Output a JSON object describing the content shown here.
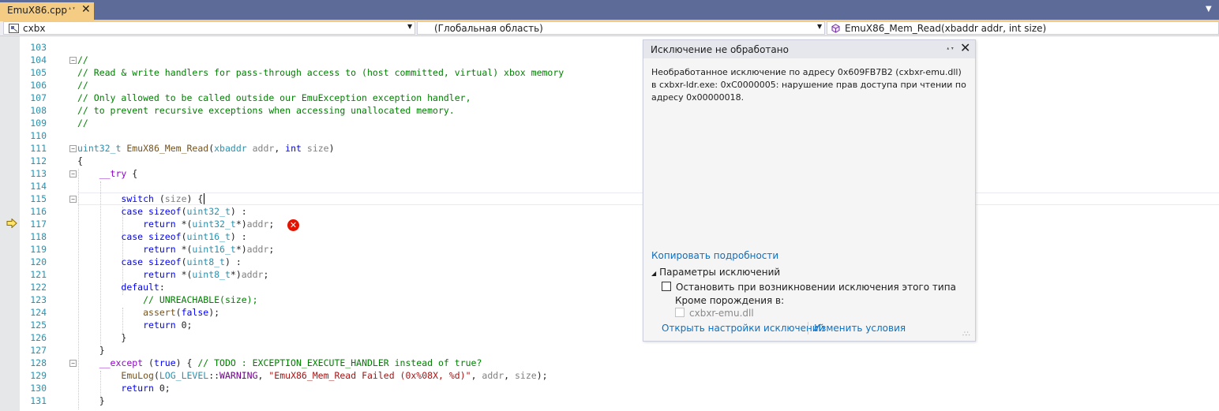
{
  "tab": {
    "title": "EmuX86.cpp",
    "pin_icon": "pin-icon",
    "close_icon": "close-icon"
  },
  "navbar": {
    "project": "cxbx",
    "scope": "(Глобальная область)",
    "member": "EmuX86_Mem_Read(xbaddr addr, int size)"
  },
  "code": {
    "line_numbers": [
      "103",
      "104",
      "105",
      "106",
      "107",
      "108",
      "109",
      "110",
      "111",
      "112",
      "113",
      "114",
      "115",
      "116",
      "117",
      "118",
      "119",
      "120",
      "121",
      "122",
      "123",
      "124",
      "125",
      "126",
      "127",
      "128",
      "129",
      "130",
      "131"
    ],
    "lines": [
      "",
      "//",
      "// Read & write handlers for pass-through access to (host committed, virtual) xbox memory",
      "//",
      "// Only allowed to be called outside our EmuException exception handler,",
      "// to prevent recursive exceptions when accessing unallocated memory.",
      "//",
      "",
      "uint32_t EmuX86_Mem_Read(xbaddr addr, int size)",
      "{",
      "    __try {",
      "",
      "        switch (size) {",
      "        case sizeof(uint32_t) :",
      "            return *(uint32_t*)addr;",
      "        case sizeof(uint16_t) :",
      "            return *(uint16_t*)addr;",
      "        case sizeof(uint8_t) :",
      "            return *(uint8_t*)addr;",
      "        default:",
      "            // UNREACHABLE(size);",
      "            assert(false);",
      "            return 0;",
      "        }",
      "    }",
      "    __except (true) { // TODO : EXCEPTION_EXECUTE_HANDLER instead of true?",
      "        EmuLog(LOG_LEVEL::WARNING, \"EmuX86_Mem_Read Failed (0x%08X, %d)\", addr, size);",
      "        return 0;",
      "    }"
    ],
    "current_line": "117",
    "error_line": "117"
  },
  "exception": {
    "title": "Исключение не обработано",
    "message": "Необработанное исключение по адресу 0x609FB7B2 (cxbxr-emu.dll) в cxbxr-ldr.exe: 0xC0000005: нарушение прав доступа при чтении по адресу 0x00000018.",
    "copy_details": "Копировать подробности",
    "settings_header": "Параметры исключений",
    "break_label": "Остановить при возникновении исключения этого типа",
    "break_checked": false,
    "except_label": "Кроме порождения в:",
    "module": "cxbxr-emu.dll",
    "module_checked": false,
    "open_settings": "Открыть настройки исключений",
    "edit_conditions": "Изменить условия"
  },
  "colors": {
    "tab_active": "#f5cc84",
    "tab_strip": "#5d6b99",
    "comment": "#008000",
    "keyword": "#0000ff",
    "type": "#2b91af",
    "string": "#a31515",
    "link": "#0e70c0",
    "error": "#e51400"
  }
}
